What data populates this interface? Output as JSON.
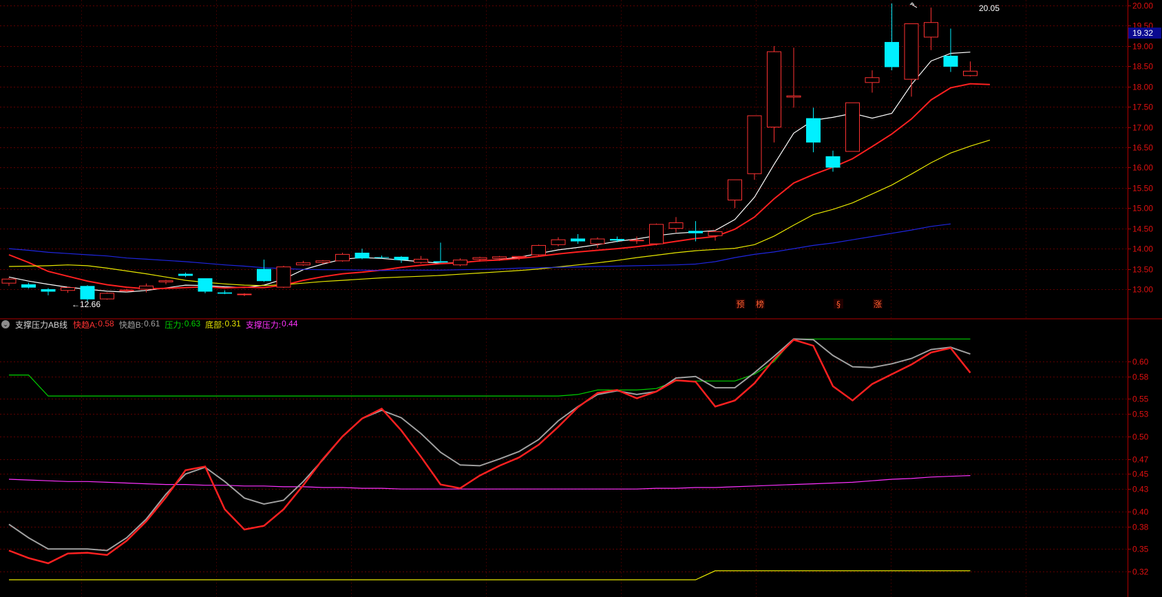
{
  "price_axis": {
    "ticks": [
      "20.00",
      "19.50",
      "19.00",
      "18.50",
      "18.00",
      "17.50",
      "17.00",
      "16.50",
      "16.00",
      "15.50",
      "15.00",
      "14.50",
      "14.00",
      "13.50",
      "13.00"
    ],
    "current_price": "19.32"
  },
  "indicator_axis": {
    "ticks": [
      "0.60",
      "0.58",
      "0.55",
      "0.53",
      "0.50",
      "0.47",
      "0.45",
      "0.43",
      "0.40",
      "0.38",
      "0.35",
      "0.32"
    ]
  },
  "indicator_header": {
    "toggle_glyph": "⌄",
    "name": "支撑压力AB线",
    "items": [
      {
        "label": "快趋A:",
        "value": "0.58",
        "color": "#ff3232"
      },
      {
        "label": "快趋B:",
        "value": "0.61",
        "color": "#a0a0a0"
      },
      {
        "label": "压力:",
        "value": "0.63",
        "color": "#00d000"
      },
      {
        "label": "底部:",
        "value": "0.31",
        "color": "#e8e800"
      },
      {
        "label": "支撑压力:",
        "value": "0.44",
        "color": "#ff32ff"
      }
    ]
  },
  "chart_data": [
    {
      "type": "candlestick",
      "ylim": [
        12.6,
        20.1
      ],
      "grid": true,
      "annotations": [
        {
          "text": "20.05",
          "kind": "high",
          "x_index": 46,
          "value": 20.05
        },
        {
          "text": "←12.66",
          "kind": "low",
          "x_index": 3,
          "value": 12.66
        }
      ],
      "markers": [
        {
          "text": "预",
          "x_index": 37
        },
        {
          "text": "榜",
          "x_index": 38
        },
        {
          "text": "§",
          "x_index": 42
        },
        {
          "text": "涨",
          "x_index": 44
        }
      ],
      "candles": [
        {
          "o": 13.15,
          "h": 13.28,
          "c": 13.25,
          "l": 13.08
        },
        {
          "o": 13.12,
          "h": 13.16,
          "c": 13.04,
          "l": 13.02
        },
        {
          "o": 13.0,
          "h": 13.03,
          "c": 12.94,
          "l": 12.85
        },
        {
          "o": 12.97,
          "h": 13.06,
          "c": 13.04,
          "l": 12.91
        },
        {
          "o": 13.08,
          "h": 13.1,
          "c": 12.75,
          "l": 12.7
        },
        {
          "o": 12.76,
          "h": 12.92,
          "c": 12.9,
          "l": 12.74
        },
        {
          "o": 12.96,
          "h": 13.01,
          "c": 12.98,
          "l": 12.93
        },
        {
          "o": 13.0,
          "h": 13.14,
          "c": 13.08,
          "l": 12.92
        },
        {
          "o": 13.18,
          "h": 13.23,
          "c": 13.21,
          "l": 13.12
        },
        {
          "o": 13.38,
          "h": 13.41,
          "c": 13.33,
          "l": 13.3
        },
        {
          "o": 13.27,
          "h": 13.27,
          "c": 12.94,
          "l": 12.9
        },
        {
          "o": 12.92,
          "h": 12.97,
          "c": 12.89,
          "l": 12.88
        },
        {
          "o": 12.87,
          "h": 12.9,
          "c": 12.88,
          "l": 12.83
        },
        {
          "o": 13.5,
          "h": 13.73,
          "c": 13.2,
          "l": 13.18
        },
        {
          "o": 13.05,
          "h": 13.58,
          "c": 13.55,
          "l": 13.03
        },
        {
          "o": 13.6,
          "h": 13.7,
          "c": 13.65,
          "l": 13.58
        },
        {
          "o": 13.66,
          "h": 13.72,
          "c": 13.7,
          "l": 13.62
        },
        {
          "o": 13.7,
          "h": 13.9,
          "c": 13.86,
          "l": 13.68
        },
        {
          "o": 13.9,
          "h": 14.0,
          "c": 13.76,
          "l": 13.74
        },
        {
          "o": 13.79,
          "h": 13.83,
          "c": 13.78,
          "l": 13.76
        },
        {
          "o": 13.8,
          "h": 13.82,
          "c": 13.72,
          "l": 13.65
        },
        {
          "o": 13.66,
          "h": 13.82,
          "c": 13.74,
          "l": 13.63
        },
        {
          "o": 13.69,
          "h": 14.15,
          "c": 13.66,
          "l": 13.65
        },
        {
          "o": 13.6,
          "h": 13.76,
          "c": 13.72,
          "l": 13.57
        },
        {
          "o": 13.74,
          "h": 13.8,
          "c": 13.78,
          "l": 13.68
        },
        {
          "o": 13.76,
          "h": 13.82,
          "c": 13.8,
          "l": 13.7
        },
        {
          "o": 13.79,
          "h": 13.82,
          "c": 13.81,
          "l": 13.72
        },
        {
          "o": 13.85,
          "h": 14.1,
          "c": 14.08,
          "l": 13.82
        },
        {
          "o": 14.1,
          "h": 14.28,
          "c": 14.22,
          "l": 14.06
        },
        {
          "o": 14.25,
          "h": 14.36,
          "c": 14.18,
          "l": 14.12
        },
        {
          "o": 14.12,
          "h": 14.28,
          "c": 14.24,
          "l": 14.02
        },
        {
          "o": 14.24,
          "h": 14.3,
          "c": 14.2,
          "l": 14.16
        },
        {
          "o": 14.2,
          "h": 14.3,
          "c": 14.21,
          "l": 14.12
        },
        {
          "o": 14.12,
          "h": 14.62,
          "c": 14.6,
          "l": 14.08
        },
        {
          "o": 14.5,
          "h": 14.78,
          "c": 14.64,
          "l": 14.4
        },
        {
          "o": 14.44,
          "h": 14.68,
          "c": 14.38,
          "l": 14.18
        },
        {
          "o": 14.32,
          "h": 14.46,
          "c": 14.42,
          "l": 14.2
        },
        {
          "o": 15.2,
          "h": 15.7,
          "c": 15.7,
          "l": 15.0
        },
        {
          "o": 15.85,
          "h": 17.28,
          "c": 17.28,
          "l": 15.7
        },
        {
          "o": 17.0,
          "h": 19.0,
          "c": 18.86,
          "l": 16.62
        },
        {
          "o": 17.74,
          "h": 18.96,
          "c": 17.77,
          "l": 17.48
        },
        {
          "o": 17.22,
          "h": 17.48,
          "c": 16.62,
          "l": 16.38
        },
        {
          "o": 16.28,
          "h": 16.42,
          "c": 16.0,
          "l": 15.9
        },
        {
          "o": 16.4,
          "h": 17.6,
          "c": 17.6,
          "l": 16.4
        },
        {
          "o": 18.1,
          "h": 18.4,
          "c": 18.22,
          "l": 17.85
        },
        {
          "o": 19.1,
          "h": 20.05,
          "c": 18.48,
          "l": 18.4
        },
        {
          "o": 18.18,
          "h": 19.55,
          "c": 19.55,
          "l": 17.75
        },
        {
          "o": 19.22,
          "h": 19.95,
          "c": 19.58,
          "l": 18.9
        },
        {
          "o": 18.76,
          "h": 19.43,
          "c": 18.49,
          "l": 18.36
        },
        {
          "o": 18.27,
          "h": 18.62,
          "c": 18.38,
          "l": 18.25
        }
      ],
      "series": [
        {
          "color": "#ffffff",
          "values": [
            13.3,
            13.2,
            13.12,
            13.05,
            13.0,
            12.95,
            12.93,
            12.97,
            13.03,
            13.1,
            13.09,
            13.06,
            13.04,
            13.1,
            13.25,
            13.48,
            13.62,
            13.74,
            13.78,
            13.76,
            13.72,
            13.68,
            13.64,
            13.66,
            13.7,
            13.73,
            13.79,
            13.88,
            13.97,
            14.03,
            14.1,
            14.18,
            14.24,
            14.32,
            14.38,
            14.41,
            14.45,
            14.72,
            15.27,
            16.08,
            16.85,
            17.17,
            17.24,
            17.34,
            17.22,
            17.34,
            18.05,
            18.63,
            18.82,
            18.85
          ]
        },
        {
          "color": "#ff2020",
          "values": [
            13.85,
            13.66,
            13.44,
            13.32,
            13.2,
            13.11,
            13.05,
            13.01,
            13.02,
            13.04,
            13.06,
            13.03,
            13.05,
            13.04,
            13.1,
            13.22,
            13.31,
            13.38,
            13.42,
            13.47,
            13.54,
            13.59,
            13.63,
            13.65,
            13.7,
            13.72,
            13.76,
            13.81,
            13.87,
            13.92,
            13.96,
            14.0,
            14.05,
            14.11,
            14.18,
            14.25,
            14.3,
            14.48,
            14.78,
            15.23,
            15.62,
            15.83,
            16.01,
            16.22,
            16.52,
            16.83,
            17.2,
            17.67,
            17.97,
            18.07,
            18.05
          ]
        },
        {
          "color": "#e8e800",
          "values": [
            13.56,
            13.57,
            13.58,
            13.6,
            13.58,
            13.52,
            13.45,
            13.38,
            13.3,
            13.22,
            13.17,
            13.13,
            13.1,
            13.09,
            13.11,
            13.15,
            13.19,
            13.22,
            13.25,
            13.28,
            13.3,
            13.32,
            13.34,
            13.37,
            13.4,
            13.43,
            13.46,
            13.5,
            13.55,
            13.6,
            13.65,
            13.71,
            13.78,
            13.84,
            13.9,
            13.95,
            13.98,
            14.01,
            14.1,
            14.31,
            14.58,
            14.84,
            14.97,
            15.13,
            15.35,
            15.57,
            15.84,
            16.12,
            16.36,
            16.53,
            16.68
          ]
        },
        {
          "color": "#1f26e0",
          "values": [
            14.0,
            13.96,
            13.91,
            13.88,
            13.85,
            13.82,
            13.77,
            13.74,
            13.71,
            13.68,
            13.64,
            13.6,
            13.57,
            13.53,
            13.51,
            13.49,
            13.48,
            13.48,
            13.47,
            13.46,
            13.47,
            13.47,
            13.47,
            13.48,
            13.49,
            13.5,
            13.52,
            13.53,
            13.54,
            13.55,
            13.56,
            13.57,
            13.58,
            13.59,
            13.6,
            13.62,
            13.68,
            13.78,
            13.86,
            13.92,
            14.0,
            14.08,
            14.14,
            14.22,
            14.3,
            14.38,
            14.46,
            14.55,
            14.61
          ]
        }
      ]
    },
    {
      "type": "line",
      "title": "支撑压力AB线",
      "ylim": [
        0.305,
        0.66
      ],
      "grid": true,
      "series": [
        {
          "name": "快趋A",
          "color": "#ff2020",
          "values": [
            0.348,
            0.338,
            0.331,
            0.344,
            0.345,
            0.342,
            0.361,
            0.387,
            0.419,
            0.455,
            0.46,
            0.403,
            0.376,
            0.381,
            0.403,
            0.435,
            0.47,
            0.5,
            0.524,
            0.537,
            0.508,
            0.473,
            0.436,
            0.431,
            0.448,
            0.461,
            0.472,
            0.489,
            0.513,
            0.539,
            0.558,
            0.562,
            0.551,
            0.56,
            0.575,
            0.573,
            0.54,
            0.548,
            0.571,
            0.603,
            0.629,
            0.621,
            0.567,
            0.548,
            0.57,
            0.583,
            0.596,
            0.612,
            0.618,
            0.585
          ]
        },
        {
          "name": "快趋B",
          "color": "#a0a0a0",
          "values": [
            0.383,
            0.365,
            0.35,
            0.35,
            0.35,
            0.348,
            0.365,
            0.39,
            0.423,
            0.45,
            0.459,
            0.44,
            0.418,
            0.41,
            0.415,
            0.44,
            0.469,
            0.5,
            0.524,
            0.535,
            0.525,
            0.504,
            0.479,
            0.462,
            0.461,
            0.47,
            0.48,
            0.496,
            0.521,
            0.54,
            0.556,
            0.561,
            0.556,
            0.56,
            0.578,
            0.58,
            0.565,
            0.565,
            0.585,
            0.607,
            0.63,
            0.629,
            0.608,
            0.593,
            0.592,
            0.597,
            0.604,
            0.616,
            0.619,
            0.61
          ]
        },
        {
          "name": "压力",
          "color": "#00d000",
          "values": [
            0.582,
            0.582,
            0.554,
            0.554,
            0.554,
            0.554,
            0.554,
            0.554,
            0.554,
            0.554,
            0.554,
            0.554,
            0.554,
            0.554,
            0.554,
            0.554,
            0.554,
            0.554,
            0.554,
            0.554,
            0.554,
            0.554,
            0.554,
            0.554,
            0.554,
            0.554,
            0.554,
            0.554,
            0.554,
            0.556,
            0.562,
            0.562,
            0.562,
            0.564,
            0.574,
            0.574,
            0.574,
            0.574,
            0.583,
            0.6,
            0.63,
            0.63,
            0.63,
            0.63,
            0.63,
            0.63,
            0.63,
            0.63,
            0.63,
            0.63
          ]
        },
        {
          "name": "底部",
          "color": "#e8e800",
          "values": [
            0.309,
            0.309,
            0.309,
            0.309,
            0.309,
            0.309,
            0.309,
            0.309,
            0.309,
            0.309,
            0.309,
            0.309,
            0.309,
            0.309,
            0.309,
            0.309,
            0.309,
            0.309,
            0.309,
            0.309,
            0.309,
            0.309,
            0.309,
            0.309,
            0.309,
            0.309,
            0.309,
            0.309,
            0.309,
            0.309,
            0.309,
            0.309,
            0.309,
            0.309,
            0.309,
            0.309,
            0.321,
            0.321,
            0.321,
            0.321,
            0.321,
            0.321,
            0.321,
            0.321,
            0.321,
            0.321,
            0.321,
            0.321,
            0.321,
            0.321
          ]
        },
        {
          "name": "支撑压力",
          "color": "#ff32ff",
          "values": [
            0.443,
            0.442,
            0.441,
            0.44,
            0.44,
            0.439,
            0.438,
            0.437,
            0.436,
            0.436,
            0.435,
            0.435,
            0.434,
            0.434,
            0.433,
            0.433,
            0.432,
            0.432,
            0.431,
            0.431,
            0.43,
            0.43,
            0.43,
            0.43,
            0.43,
            0.43,
            0.43,
            0.43,
            0.43,
            0.43,
            0.43,
            0.43,
            0.43,
            0.431,
            0.431,
            0.432,
            0.432,
            0.433,
            0.434,
            0.435,
            0.436,
            0.437,
            0.438,
            0.439,
            0.441,
            0.443,
            0.444,
            0.446,
            0.447,
            0.448
          ]
        }
      ]
    }
  ]
}
